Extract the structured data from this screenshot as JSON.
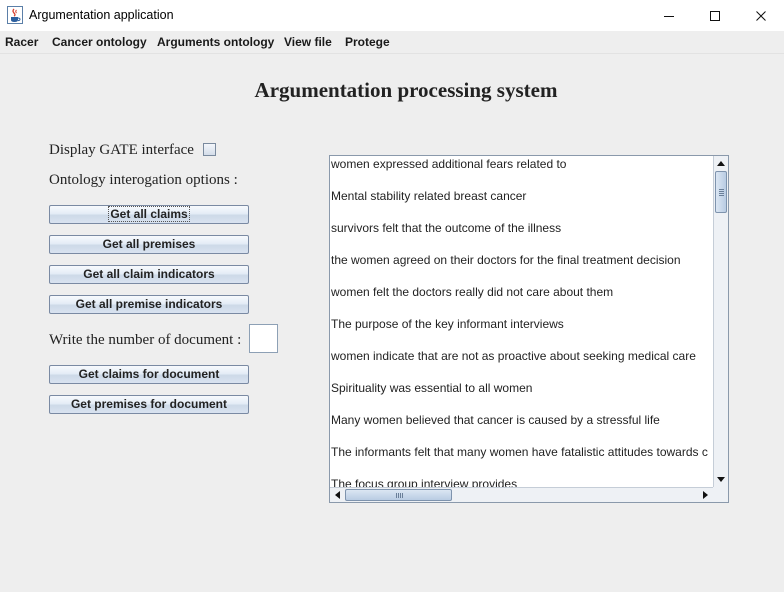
{
  "window": {
    "title": "Argumentation application",
    "icons": {
      "app": "java-cup-icon",
      "minimize": "minimize-icon",
      "maximize": "maximize-icon",
      "close": "close-icon"
    }
  },
  "menubar": {
    "items": [
      "Racer",
      "Cancer ontology",
      "Arguments ontology",
      "View file",
      "Protege"
    ]
  },
  "main": {
    "heading": "Argumentation processing system",
    "gate_label": "Display GATE interface",
    "gate_checked": false,
    "ontology_label": "Ontology interogation options :",
    "buttons": [
      "Get all claims",
      "Get all premises",
      "Get all claim indicators",
      "Get all premise indicators"
    ],
    "doc_number_label": "Write the number of document :",
    "doc_number_value": "",
    "doc_buttons": [
      "Get claims for document",
      "Get premises for document"
    ]
  },
  "results": {
    "lines": [
      "women expressed additional fears related to",
      "Mental stability related breast cancer",
      "survivors felt that the outcome of the illness",
      " the women agreed on their doctors for the final treatment decision",
      "women felt the doctors really did not care about them",
      "The purpose of the key informant interviews",
      " women indicate that are not as proactive about seeking medical care",
      "Spirituality was essential to all women",
      "Many women believed that cancer is caused by a stressful life",
      "The informants felt that many women have fatalistic attitudes towards c",
      "The focus group interview provides"
    ],
    "scroll_icons": {
      "up": "scroll-up-arrow-icon",
      "down": "scroll-down-arrow-icon",
      "left": "scroll-left-arrow-icon",
      "right": "scroll-right-arrow-icon"
    }
  },
  "colors": {
    "background": "#eeeeee",
    "button_border": "#7a8aa3",
    "button_fill": "#d9e3f0",
    "text": "#222222"
  }
}
